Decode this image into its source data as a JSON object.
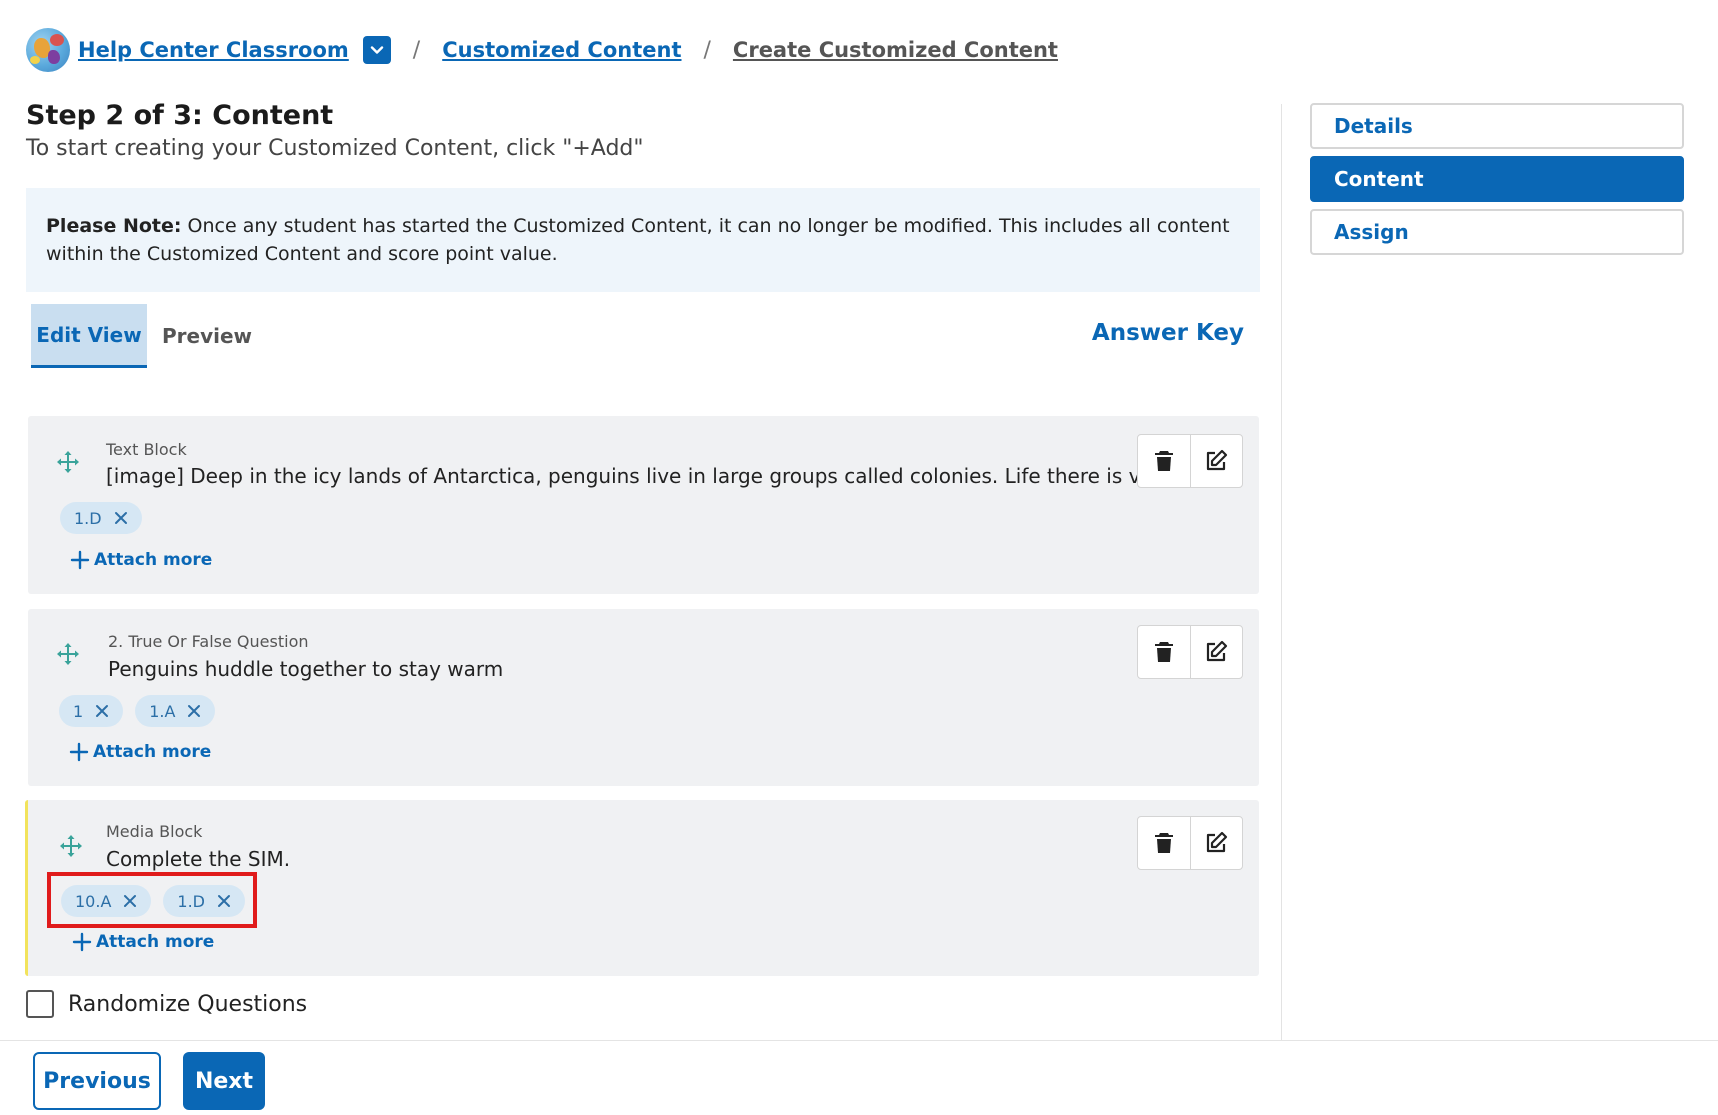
{
  "breadcrumb": {
    "class_name": "Help Center Classroom",
    "section": "Customized Content",
    "current": "Create Customized Content",
    "separator": "/"
  },
  "header": {
    "title": "Step 2 of 3: Content",
    "subtitle": "To start creating your Customized Content, click \"+Add\""
  },
  "note": {
    "label": "Please Note:",
    "text": " Once any student has started the Customized Content, it can no longer be modified. This includes all content within the Customized Content and score point value."
  },
  "tabs": {
    "edit": "Edit View",
    "preview": "Preview",
    "active": "edit"
  },
  "answer_key": "Answer Key",
  "blocks": [
    {
      "type": "Text Block",
      "text": "[image] Deep in the icy lands of Antarctica, penguins live in large groups called colonies. Life there is very",
      "tags": [
        "1.D"
      ],
      "attach_label": "Attach more"
    },
    {
      "type": "2. True Or False Question",
      "text": "Penguins huddle together to stay warm",
      "tags": [
        "1",
        "1.A"
      ],
      "attach_label": "Attach more"
    },
    {
      "type": "Media Block",
      "text": "Complete the SIM.",
      "tags": [
        "10.A",
        "1.D"
      ],
      "attach_label": "Attach more"
    }
  ],
  "randomize": {
    "label": "Randomize Questions",
    "checked": false
  },
  "sidebar": {
    "items": [
      {
        "label": "Details",
        "active": false
      },
      {
        "label": "Content",
        "active": true
      },
      {
        "label": "Assign",
        "active": false
      }
    ]
  },
  "footer": {
    "previous": "Previous",
    "next": "Next"
  },
  "colors": {
    "primary": "#0a67b5",
    "tag_bg": "#d6e7f4",
    "note_bg": "#eef5fb",
    "block_bg": "#f0f1f3",
    "drag_icon": "#3aa39a",
    "highlight": "#e01b1b",
    "active_accent": "#f2e35c"
  },
  "icons": {
    "drag": "move-arrows-icon",
    "delete": "trash-icon",
    "edit": "edit-pencil-icon",
    "remove_tag": "close-icon",
    "add": "plus-icon",
    "dropdown": "chevron-down-icon"
  }
}
